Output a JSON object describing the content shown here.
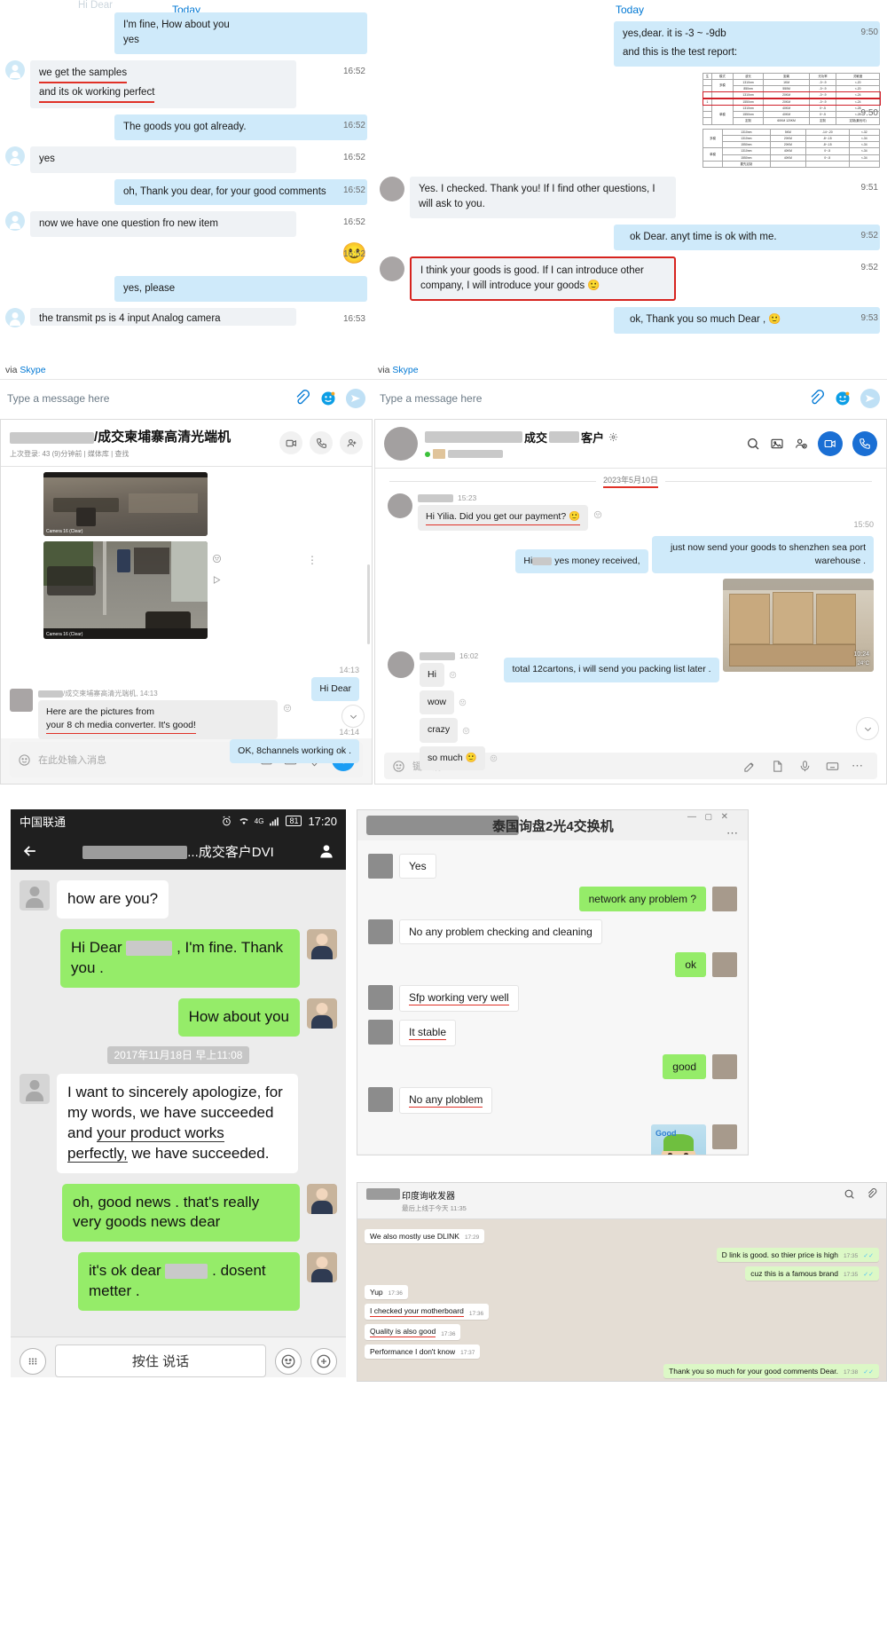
{
  "panel_skype_left": {
    "name": "skype-chat-left",
    "today_label": "Today",
    "ghost_top": "Hi Dear",
    "messages": [
      {
        "side": "out",
        "lines": [
          "I'm fine, How about you",
          "yes"
        ],
        "time": ""
      },
      {
        "side": "in",
        "lines": [
          "we get the samples",
          "and its ok working perfect"
        ],
        "time": "16:52",
        "underline": true
      },
      {
        "side": "out",
        "lines": [
          "The goods you got already."
        ],
        "time": "16:52"
      },
      {
        "side": "in",
        "lines": [
          "yes"
        ],
        "time": "16:52"
      },
      {
        "side": "out",
        "lines": [
          "oh, Thank you dear, for your good comments"
        ],
        "time": "16:52"
      },
      {
        "side": "in",
        "lines": [
          "now we have one question fro new item"
        ],
        "time": "16:52"
      },
      {
        "side": "out",
        "lines": [
          "emoji-smile"
        ],
        "time": "16:52",
        "emoji": true
      },
      {
        "side": "out",
        "lines": [
          "yes, please"
        ],
        "time": ""
      },
      {
        "side": "in",
        "lines": [
          "the transmit ps  is 4 input Analog camera"
        ],
        "time": "16:53"
      }
    ],
    "via_label": "via",
    "via_app": "Skype",
    "input_placeholder": "Type a message here",
    "icons": [
      "attach-icon",
      "emoji-icon",
      "send-icon"
    ]
  },
  "panel_skype_right": {
    "name": "skype-chat-right",
    "today_label": "Today",
    "messages": [
      {
        "side": "out",
        "lines": [
          "yes,dear. it is -3 ~ -9db",
          "and this is the test report:"
        ],
        "time": "9:50"
      },
      {
        "side": "out",
        "lines": [
          "image-test-report"
        ],
        "time": "9:50",
        "image": true
      },
      {
        "side": "in",
        "lines": [
          "Yes. I checked. Thank you! If I find other questions, I",
          "will ask to you."
        ],
        "time": "9:51"
      },
      {
        "side": "out",
        "lines": [
          "ok Dear. anyt time is ok with me."
        ],
        "time": "9:52"
      },
      {
        "side": "in",
        "lines": [
          "I think your goods is good. If I can introduce other",
          "company, I will introduce your goods 🙂"
        ],
        "time": "9:52",
        "highlight": true
      },
      {
        "side": "out",
        "lines": [
          "ok, Thank you so much Dear , 🙂"
        ],
        "time": "9:53"
      }
    ],
    "report_table": {
      "headers": [
        "生",
        "模式",
        "波长",
        "距离",
        "光功率",
        "灵敏度"
      ],
      "rows": [
        [
          "",
          "多模",
          "1310nm",
          "1KM",
          "-3~-9",
          "<-20"
        ],
        [
          "",
          "",
          "850nm",
          "550M",
          "-3~-9",
          "<-20"
        ],
        [
          "",
          "",
          "1310nm",
          "20KM",
          "-3~-9",
          "<-24"
        ],
        [
          "1",
          "",
          "1550nm",
          "20KM",
          "-3~-9",
          "<-24"
        ],
        [
          "",
          "单模",
          "1310nm",
          "40KM",
          "0~-5",
          "<-28"
        ],
        [
          "",
          "",
          "1550nm",
          "40KM",
          "0~-5",
          "<-28"
        ],
        [
          "",
          "",
          "定制",
          "60KM 120KM",
          "定制",
          "定制(最优可》"
        ]
      ],
      "rows2": [
        [
          "多模",
          "1310nm",
          "5KM",
          "-14~-20",
          "<-32"
        ],
        [
          "",
          "1310nm",
          "20KM",
          "-8~-15",
          "<-34"
        ],
        [
          "",
          "1550nm",
          "20KM",
          "-8~-15",
          "<-34"
        ],
        [
          "单模",
          "1310nm",
          "40KM",
          "0~-5",
          "<-34"
        ],
        [
          "",
          "1550nm",
          "40KM",
          "0~-5",
          "<-34"
        ],
        [
          "",
          "",
          "要先定制",
          "",
          ""
        ]
      ]
    },
    "via_label": "via",
    "via_app": "Skype",
    "input_placeholder": "Type a message here"
  },
  "panel_wechat_left": {
    "name": "wechat-desktop-left",
    "title_suffix": "/成交柬埔寨高清光端机",
    "subtitle": "上次登录: 43 (9)分钟前 | 媒体库 | 查找",
    "header_icons": [
      "video-call-icon",
      "phone-call-icon",
      "add-person-icon"
    ],
    "camera_labels": [
      "Camera 16 (Clear)",
      "Camera 16 (Clear)"
    ],
    "messages": [
      {
        "side": "out",
        "text": "Hi Dear",
        "time": "14:13"
      },
      {
        "side": "in",
        "name": "/成交柬埔寨高清光端机,",
        "time": "14:13",
        "text": "Here are the pictures from your 8 ch media converter. It's good!",
        "underline_from": "your 8 ch media converter. It's good!"
      },
      {
        "side": "out",
        "text": "OK, 8channels working ok .",
        "time": "14:14"
      }
    ],
    "input_placeholder": "在此处输入消息",
    "input_icons": [
      "image-icon",
      "card-icon",
      "location-icon",
      "plus-icon",
      "emoji-icon"
    ]
  },
  "panel_wechat_right": {
    "name": "wechat-desktop-right",
    "title_parts": [
      "成交",
      "客户"
    ],
    "header_icons": [
      "search-icon",
      "gallery-icon",
      "add-member-icon",
      "video-call-icon",
      "voice-call-icon",
      "gear-icon"
    ],
    "date_divider": "2023年5月10日",
    "messages": [
      {
        "side": "in",
        "time": "15:23",
        "text": "Hi Yilia. Did you get our payment? 🙂",
        "underline": true
      },
      {
        "side": "out",
        "time": "15:50",
        "text": "Hi ____ yes money received,"
      },
      {
        "side": "out",
        "text": "just now send your goods to shenzhen sea port warehouse ."
      },
      {
        "side": "out",
        "text": "total 12cartons, i will send you packing list later ."
      },
      {
        "side": "out",
        "text": "image-cartons"
      },
      {
        "side": "in",
        "time": "16:02",
        "text": "Hi"
      },
      {
        "side": "in",
        "text": "wow"
      },
      {
        "side": "in",
        "text": "crazy"
      },
      {
        "side": "in",
        "text": "so much 🙂"
      }
    ],
    "photo_overlay": {
      "time": "10:24",
      "temp": "24°C"
    },
    "input_placeholder": "键入消息",
    "input_icons": [
      "emoji-icon",
      "handwriting-icon",
      "file-icon",
      "mic-icon",
      "keyboard-icon",
      "more-icon"
    ]
  },
  "panel_phone": {
    "name": "android-wechat-phone",
    "carrier": "中国联通",
    "status_icons": [
      "alarm-icon",
      "wifi-icon",
      "4g-signal-icon",
      "battery-icon"
    ],
    "battery_level": "81",
    "clock": "17:20",
    "chat_title": "...成交客户DVI",
    "back_icon": "back-arrow-icon",
    "profile_icon": "contact-icon",
    "messages": [
      {
        "side": "in",
        "text": "how are you?"
      },
      {
        "side": "out",
        "text": "Hi Dear ____ , I'm fine. Thank you ."
      },
      {
        "side": "out",
        "text": "How about you"
      },
      {
        "side": "date",
        "text": "2017年11月18日 早上11:08"
      },
      {
        "side": "in",
        "text": "I want to sincerely apologize, for my words, we have succeeded and your product works perfectly, we have succeeded.",
        "underline_part": "your product works perfectly,"
      },
      {
        "side": "out",
        "text": "oh, good news . that's really very goods news dear"
      },
      {
        "side": "out",
        "text": "it's ok dear ____ . dosent metter ."
      }
    ],
    "footer": {
      "keyboard_icon": "keyboard-icon",
      "talk_label": "按住 说话",
      "emoji_icon": "emoji-icon",
      "plus_icon": "plus-icon"
    },
    "nav_icons": [
      "back-triangle-icon",
      "home-circle-icon",
      "recents-square-icon"
    ]
  },
  "panel_wa_top": {
    "name": "whatsapp-thailand-chat",
    "title_suffix": "泰国询盘2光4交换机",
    "window_icons": [
      "minimize-icon",
      "maximize-icon",
      "close-icon",
      "more-icon"
    ],
    "messages": [
      {
        "side": "in",
        "text": "Yes"
      },
      {
        "side": "out",
        "text": "network any problem ?"
      },
      {
        "side": "in",
        "text": "No any problem  checking and cleaning"
      },
      {
        "side": "out",
        "text": "ok"
      },
      {
        "side": "in",
        "text": "Sfp working very well",
        "underline": true
      },
      {
        "side": "in",
        "text": "It stable",
        "underline": true
      },
      {
        "side": "out",
        "text": "good"
      },
      {
        "side": "in",
        "text": "No any ploblem",
        "underline": true
      },
      {
        "side": "out",
        "text": "image-baby-good-sticker"
      }
    ]
  },
  "panel_wa_bottom": {
    "name": "whatsapp-india-chat",
    "title": "印度询收发器",
    "subtitle": "最后上线于今天 11:35",
    "header_icons": [
      "search-icon",
      "attach-icon"
    ],
    "messages": [
      {
        "side": "in",
        "text": "We also mostly use DLINK",
        "time": "17:29"
      },
      {
        "side": "out",
        "text": "D link is good. so thier price is high",
        "time": "17:35"
      },
      {
        "side": "out",
        "text": "cuz this is a famous brand",
        "time": "17:35"
      },
      {
        "side": "in",
        "text": "Yup",
        "time": "17:36"
      },
      {
        "side": "in",
        "text": "I checked your motherboard",
        "time": "17:36",
        "underline": true
      },
      {
        "side": "in",
        "text": "Quality is also good",
        "time": "17:36",
        "underline": true
      },
      {
        "side": "in",
        "text": "Performance I don't know",
        "time": "17:37"
      },
      {
        "side": "out",
        "text": "Thank you so much for your good comments Dear.",
        "time": "17:38"
      }
    ]
  },
  "colors": {
    "skype_blue": "#cfeafa",
    "skype_grey": "#eff2f5",
    "wechat_green": "#95ec69",
    "highlight_red": "#d6231e",
    "accent_blue": "#0078d4",
    "whatsapp_green": "#dcf8c6"
  }
}
